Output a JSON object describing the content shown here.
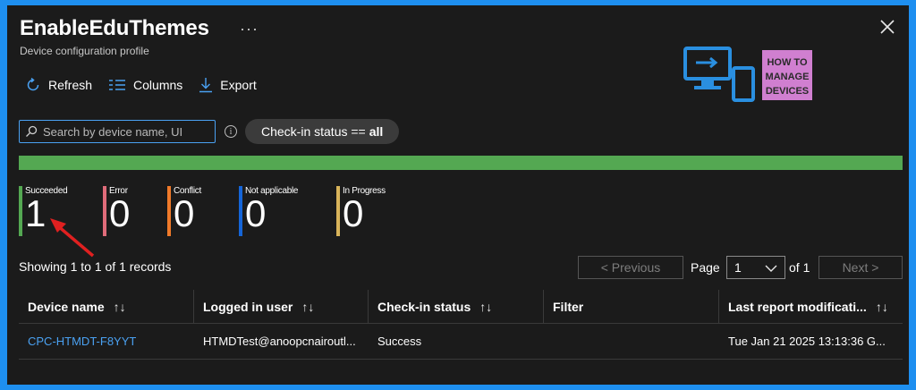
{
  "header": {
    "title": "EnableEduThemes",
    "more": "···",
    "subtitle": "Device configuration profile"
  },
  "toolbar": {
    "refresh_label": "Refresh",
    "columns_label": "Columns",
    "export_label": "Export"
  },
  "logo": {
    "line1": "HOW TO",
    "line2": "MANAGE",
    "line3": "DEVICES"
  },
  "search": {
    "placeholder": "Search by device name, UI",
    "value": ""
  },
  "filter": {
    "label": "Check-in status ==",
    "value": "all"
  },
  "stats": [
    {
      "label": "Succeeded",
      "value": "1",
      "color": "#54a852"
    },
    {
      "label": "Error",
      "value": "0",
      "color": "#e06c7a"
    },
    {
      "label": "Conflict",
      "value": "0",
      "color": "#f07a2a"
    },
    {
      "label": "Not applicable",
      "value": "0",
      "color": "#1565d8"
    },
    {
      "label": "In Progress",
      "value": "0",
      "color": "#d9b45a"
    }
  ],
  "showing": "Showing 1 to 1 of 1 records",
  "pagination": {
    "prev_label": "< Previous",
    "page_label": "Page",
    "page_value": "1",
    "of_label": "of 1",
    "next_label": "Next >"
  },
  "table": {
    "columns": [
      "Device name",
      "Logged in user",
      "Check-in status",
      "Filter",
      "Last report modificati..."
    ],
    "sort_glyph": "↑↓",
    "rows": [
      [
        "CPC-HTMDT-F8YYT",
        "HTMDTest@anoopcnairoutl...",
        "Success",
        "",
        "Tue Jan 21 2025 13:13:36 G..."
      ]
    ]
  },
  "colors": {
    "accent": "#4aa1f2",
    "frame": "#1e8ff0",
    "progress": "#54a852",
    "arrow": "#e02020"
  }
}
